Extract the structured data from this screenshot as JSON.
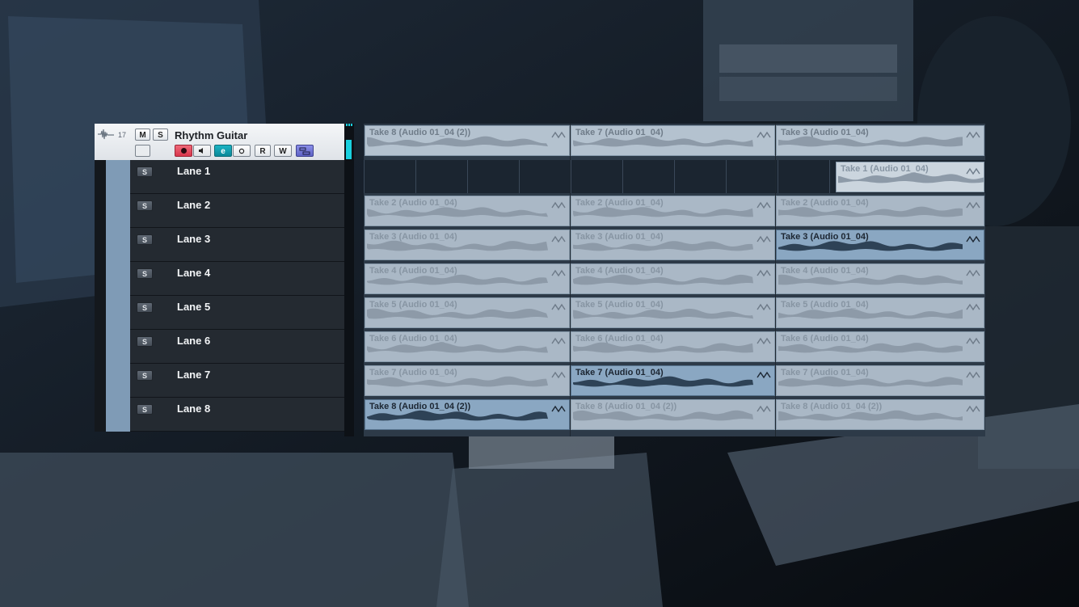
{
  "track": {
    "number": "17",
    "name": "Rhythm Guitar",
    "mute_label": "M",
    "solo_label": "S",
    "read_label": "R",
    "write_label": "W",
    "edit_label": "e",
    "icons": [
      "waveform-icon",
      "record-icon",
      "monitor-icon",
      "edit-icon",
      "lane-icon"
    ]
  },
  "lanes": [
    {
      "name": "Lane 1",
      "solo": "S"
    },
    {
      "name": "Lane 2",
      "solo": "S"
    },
    {
      "name": "Lane 3",
      "solo": "S"
    },
    {
      "name": "Lane 4",
      "solo": "S"
    },
    {
      "name": "Lane 5",
      "solo": "S"
    },
    {
      "name": "Lane 6",
      "solo": "S"
    },
    {
      "name": "Lane 7",
      "solo": "S"
    },
    {
      "name": "Lane 8",
      "solo": "S"
    }
  ],
  "composite": [
    "Take 8 (Audio 01_04 (2))",
    "Take 7 (Audio 01_04)",
    "Take 3 (Audio 01_04)"
  ],
  "lane_clips": [
    [
      "",
      "",
      "Take 1 (Audio 01_04)"
    ],
    [
      "Take 2 (Audio 01_04)",
      "Take 2 (Audio 01_04)",
      "Take 2 (Audio 01_04)"
    ],
    [
      "Take 3 (Audio 01_04)",
      "Take 3 (Audio 01_04)",
      "Take 3 (Audio 01_04)"
    ],
    [
      "Take 4 (Audio 01_04)",
      "Take 4 (Audio 01_04)",
      "Take 4 (Audio 01_04)"
    ],
    [
      "Take 5 (Audio 01_04)",
      "Take 5 (Audio 01_04)",
      "Take 5 (Audio 01_04)"
    ],
    [
      "Take 6 (Audio 01_04)",
      "Take 6 (Audio 01_04)",
      "Take 6 (Audio 01_04)"
    ],
    [
      "Take 7 (Audio 01_04)",
      "Take 7 (Audio 01_04)",
      "Take 7 (Audio 01_04)"
    ],
    [
      "Take 8 (Audio 01_04 (2))",
      "Take 8 (Audio 01_04 (2))",
      "Take 8 (Audio 01_04 (2))"
    ]
  ],
  "selected": {
    "lane3": 2,
    "lane7": 1,
    "lane8": 0
  },
  "colors": {
    "accent": "#19d0df",
    "record": "#d8364c",
    "lane_button": "#5f63c6",
    "selected_clip": "#8aa7c2"
  }
}
